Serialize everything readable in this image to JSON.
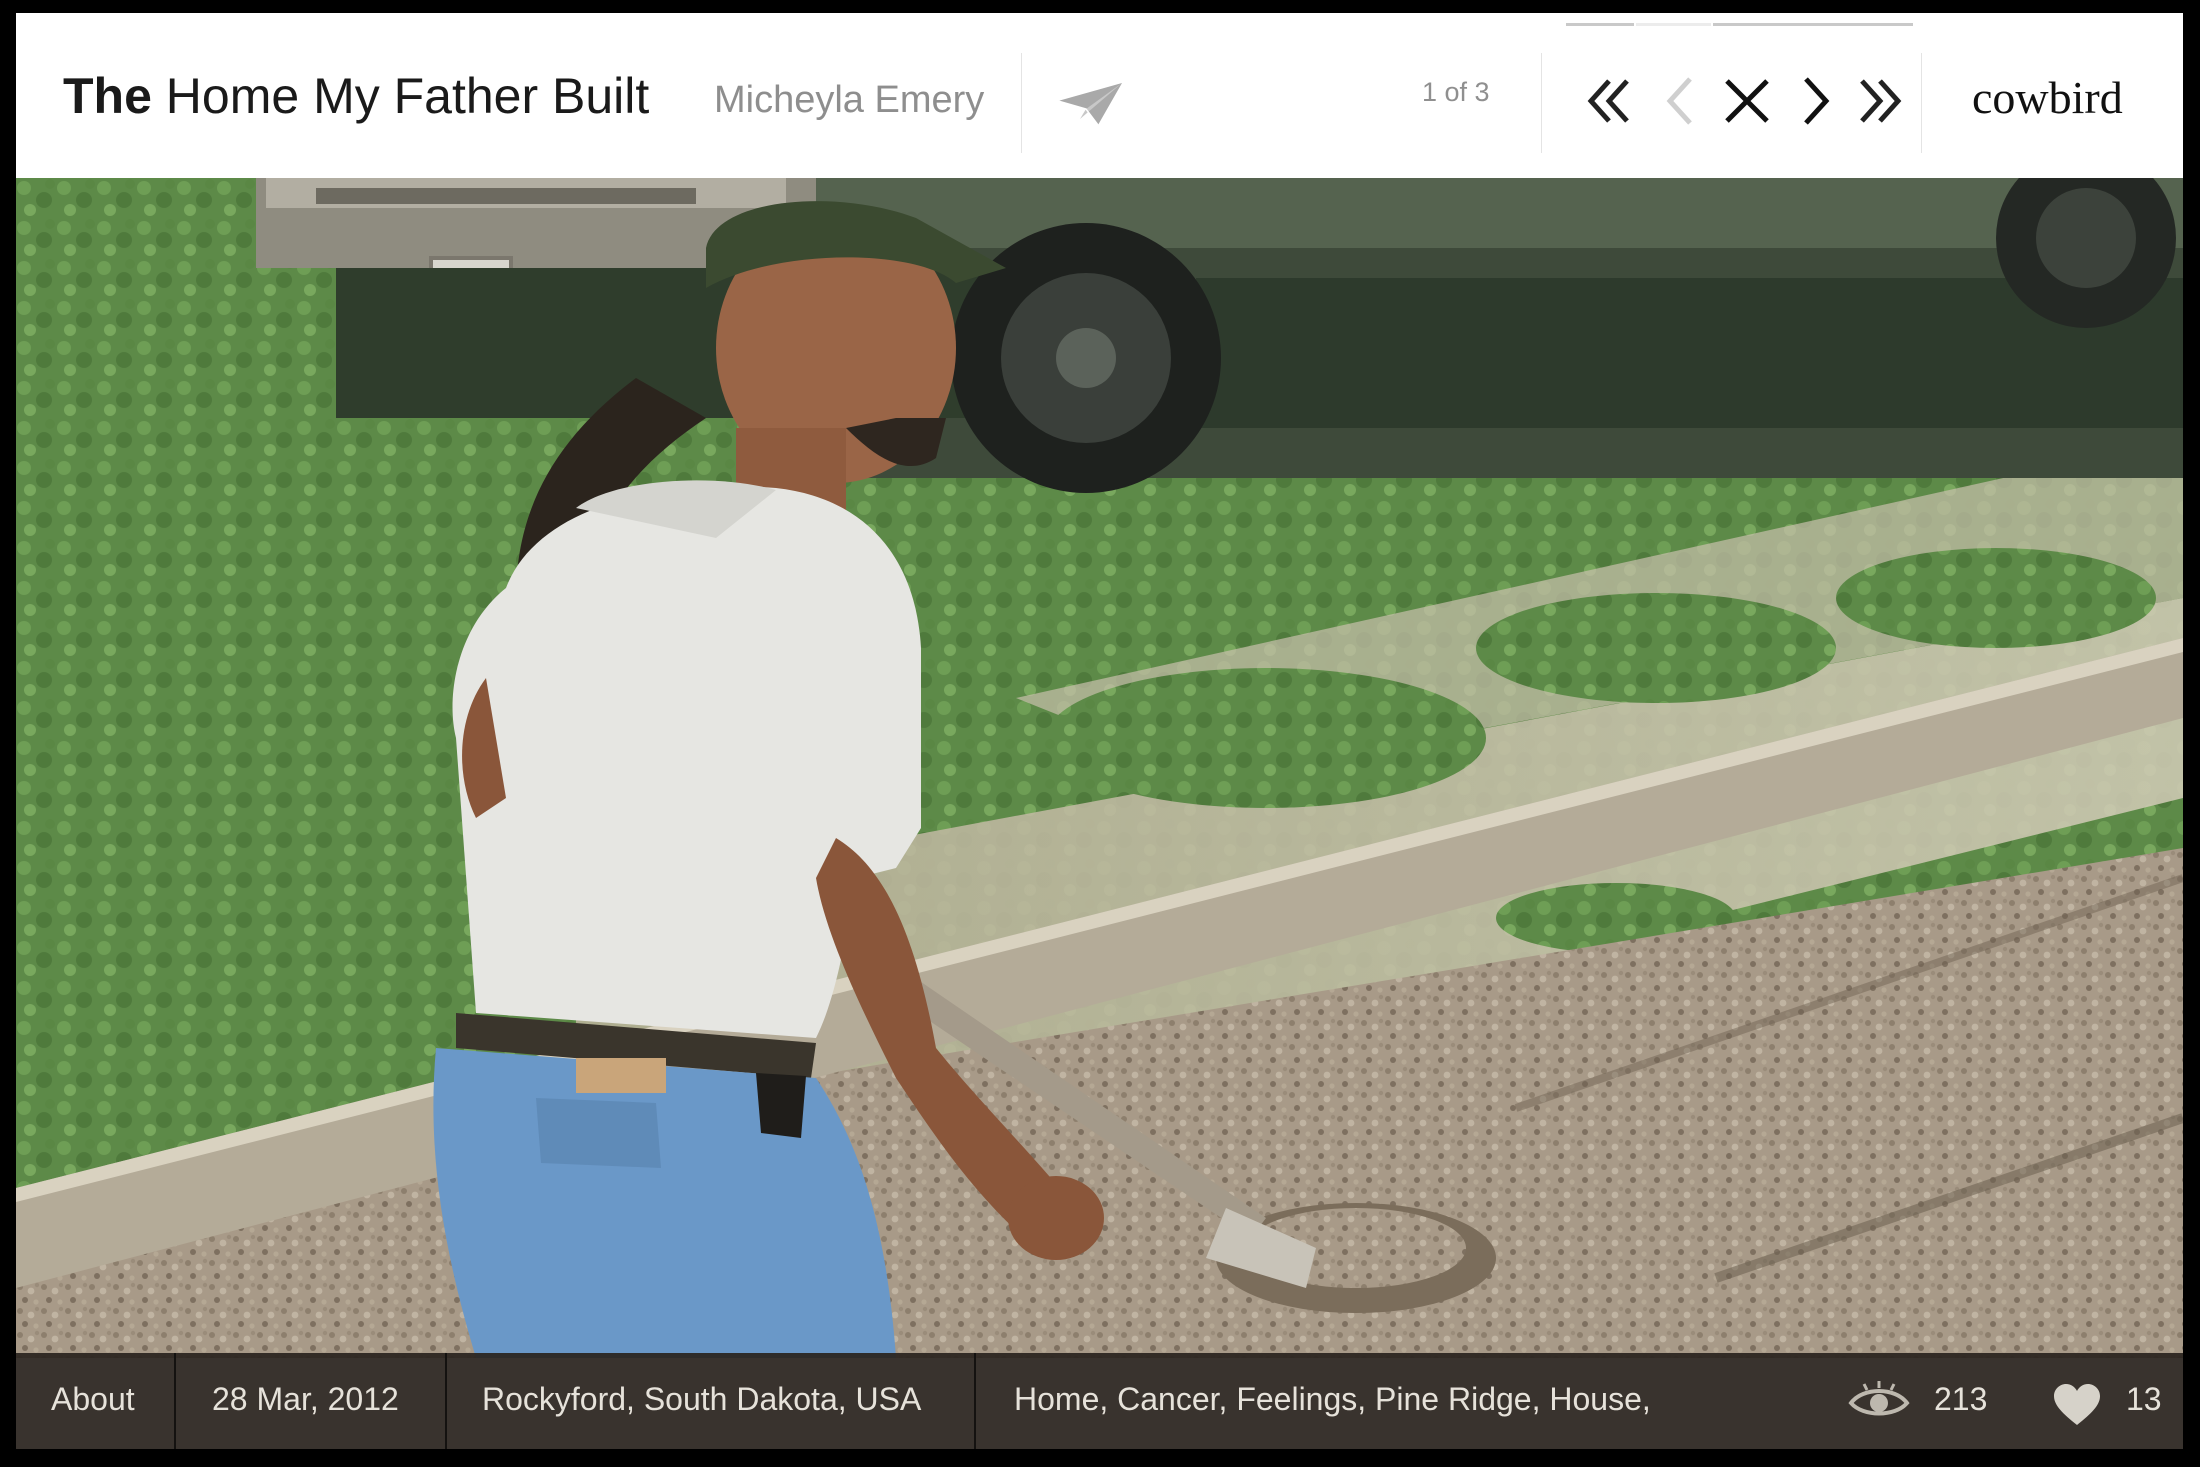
{
  "header": {
    "title_bold": "The",
    "title_rest": " Home My Father Built",
    "author": "Micheyla Emery",
    "page_counter": "1 of 3",
    "brand": "cowbird"
  },
  "nav": {
    "first_icon": "double-chevron-left-icon",
    "prev_icon": "chevron-left-icon",
    "close_icon": "close-x-icon",
    "next_icon": "chevron-right-icon",
    "last_icon": "double-chevron-right-icon",
    "share_icon": "paper-plane-icon"
  },
  "footer": {
    "about": "About",
    "date": "28 Mar, 2012",
    "location": "Rockyford, South Dakota, USA",
    "tags": "Home, Cancer, Feelings, Pine Ridge, House,",
    "views": "213",
    "loves": "13",
    "views_icon": "eye-icon",
    "loves_icon": "heart-icon"
  },
  "colors": {
    "footer_bg": "#2a241e",
    "author_gray": "#8e8e8e",
    "brand_text": "#111111"
  }
}
